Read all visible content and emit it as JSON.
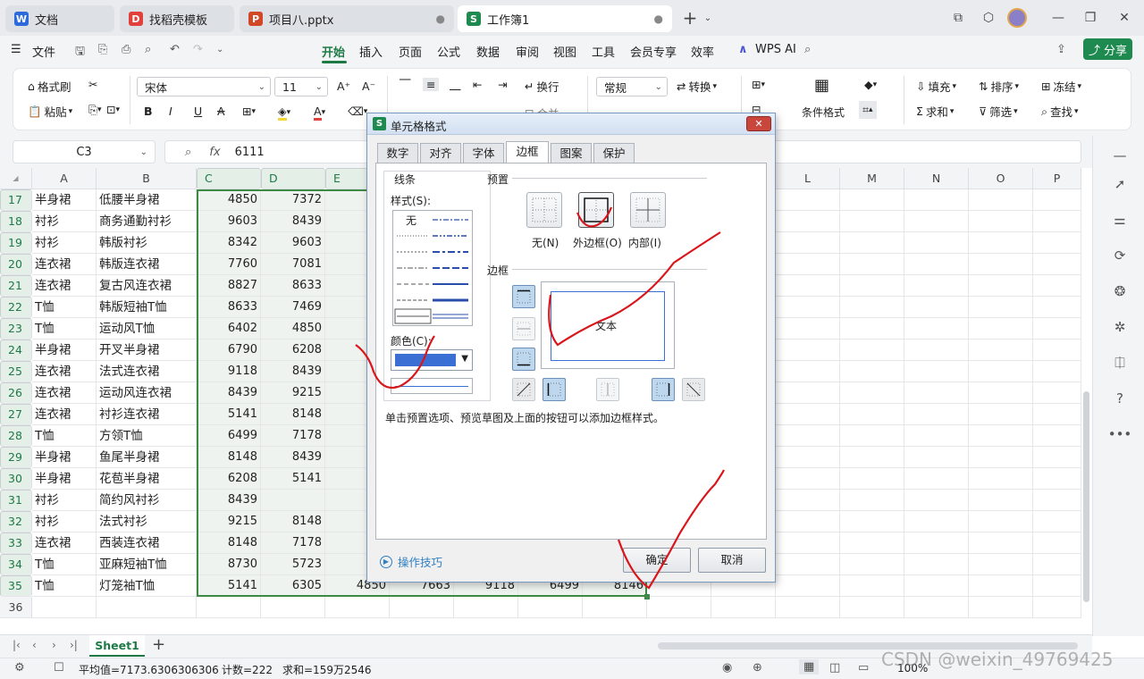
{
  "tabs": [
    {
      "label": "文档",
      "icon": "W",
      "color": "#2d6bdd"
    },
    {
      "label": "找稻壳模板",
      "icon": "D",
      "color": "#e0413a"
    },
    {
      "label": "项目八.pptx",
      "icon": "P",
      "color": "#d24726"
    },
    {
      "label": "工作簿1",
      "icon": "S",
      "color": "#1e8a4f"
    }
  ],
  "menu": {
    "file": "文件",
    "items": [
      "开始",
      "插入",
      "页面",
      "公式",
      "数据",
      "审阅",
      "视图",
      "工具",
      "会员专享",
      "效率"
    ],
    "ai": "WPS AI",
    "share": "分享"
  },
  "ribbon": {
    "format_painter": "格式刷",
    "paste": "粘贴",
    "font_name": "宋体",
    "font_size": "11",
    "wrap": "换行",
    "number_format": "常规",
    "convert": "转换",
    "cond_format": "条件格式",
    "fill": "填充",
    "sort": "排序",
    "freeze": "冻结",
    "sum": "求和",
    "filter": "筛选",
    "find": "查找",
    "merge_partial": "合并"
  },
  "formula": {
    "cell_ref": "C3",
    "fx": "fx",
    "value": "6111"
  },
  "columns": [
    "A",
    "B",
    "C",
    "D",
    "E",
    "F",
    "G",
    "H",
    "I",
    "J",
    "K",
    "L",
    "M",
    "N",
    "O",
    "P"
  ],
  "rows": [
    {
      "n": "17",
      "a": "半身裙",
      "b": "低腰半身裙",
      "c": "4850",
      "d": "7372",
      "e": "7?"
    },
    {
      "n": "18",
      "a": "衬衫",
      "b": "商务通勤衬衫",
      "c": "9603",
      "d": "8439",
      "e": "9?"
    },
    {
      "n": "19",
      "a": "衬衫",
      "b": "韩版衬衫",
      "c": "8342",
      "d": "9603",
      "e": "8?"
    },
    {
      "n": "20",
      "a": "连衣裙",
      "b": "韩版连衣裙",
      "c": "7760",
      "d": "7081",
      "e": "7?"
    },
    {
      "n": "21",
      "a": "连衣裙",
      "b": "复古风连衣裙",
      "c": "8827",
      "d": "8633",
      "e": "7?"
    },
    {
      "n": "22",
      "a": "T恤",
      "b": "韩版短袖T恤",
      "c": "8633",
      "d": "7469",
      "e": ""
    },
    {
      "n": "23",
      "a": "T恤",
      "b": "运动风T恤",
      "c": "6402",
      "d": "4850",
      "e": "5?"
    },
    {
      "n": "24",
      "a": "半身裙",
      "b": "开叉半身裙",
      "c": "6790",
      "d": "6208",
      "e": "6?"
    },
    {
      "n": "25",
      "a": "连衣裙",
      "b": "法式连衣裙",
      "c": "9118",
      "d": "8439",
      "e": "8?"
    },
    {
      "n": "26",
      "a": "连衣裙",
      "b": "运动风连衣裙",
      "c": "8439",
      "d": "9215",
      "e": "6?"
    },
    {
      "n": "27",
      "a": "连衣裙",
      "b": "衬衫连衣裙",
      "c": "5141",
      "d": "8148",
      "e": "7?"
    },
    {
      "n": "28",
      "a": "T恤",
      "b": "方领T恤",
      "c": "6499",
      "d": "7178",
      "e": "5?"
    },
    {
      "n": "29",
      "a": "半身裙",
      "b": "鱼尾半身裙",
      "c": "8148",
      "d": "8439",
      "e": "7?"
    },
    {
      "n": "30",
      "a": "半身裙",
      "b": "花苞半身裙",
      "c": "6208",
      "d": "5141",
      "e": "6?"
    },
    {
      "n": "31",
      "a": "衬衫",
      "b": "简约风衬衫",
      "c": "8439",
      "d": "",
      "e": "4?"
    },
    {
      "n": "32",
      "a": "衬衫",
      "b": "法式衬衫",
      "c": "9215",
      "d": "8148",
      "e": "7?"
    },
    {
      "n": "33",
      "a": "连衣裙",
      "b": "西装连衣裙",
      "c": "8148",
      "d": "7178",
      "e": "4?"
    },
    {
      "n": "34",
      "a": "T恤",
      "b": "亚麻短袖T恤",
      "c": "8730",
      "d": "5723",
      "e": "7?"
    },
    {
      "n": "35",
      "a": "T恤",
      "b": "灯笼袖T恤",
      "c": "5141",
      "d": "6305",
      "e": "4850",
      "f": "7663",
      "g": "9118",
      "h": "6499",
      "i": "8146"
    },
    {
      "n": "36",
      "a": "",
      "b": "",
      "c": "",
      "d": "",
      "e": ""
    }
  ],
  "sheet_tab": "Sheet1",
  "status": {
    "average": "平均值=7173.6306306306",
    "count": "计数=222",
    "sum": "求和=159万2546",
    "zoom": "100%"
  },
  "dialog": {
    "title": "单元格格式",
    "tabs": [
      "数字",
      "对齐",
      "字体",
      "边框",
      "图案",
      "保护"
    ],
    "active_tab": "边框",
    "line_group": "线条",
    "style_label": "样式(S):",
    "none_label": "无",
    "color_label": "颜色(C):",
    "color_value": "#3b6fd4",
    "preset_group": "预置",
    "presets": [
      "无(N)",
      "外边框(O)",
      "内部(I)"
    ],
    "border_group": "边框",
    "preview_text": "文本",
    "hint": "单击预置选项、预览草图及上面的按钮可以添加边框样式。",
    "tips": "操作技巧",
    "ok": "确定",
    "cancel": "取消"
  },
  "watermark": "CSDN @weixin_49769425"
}
